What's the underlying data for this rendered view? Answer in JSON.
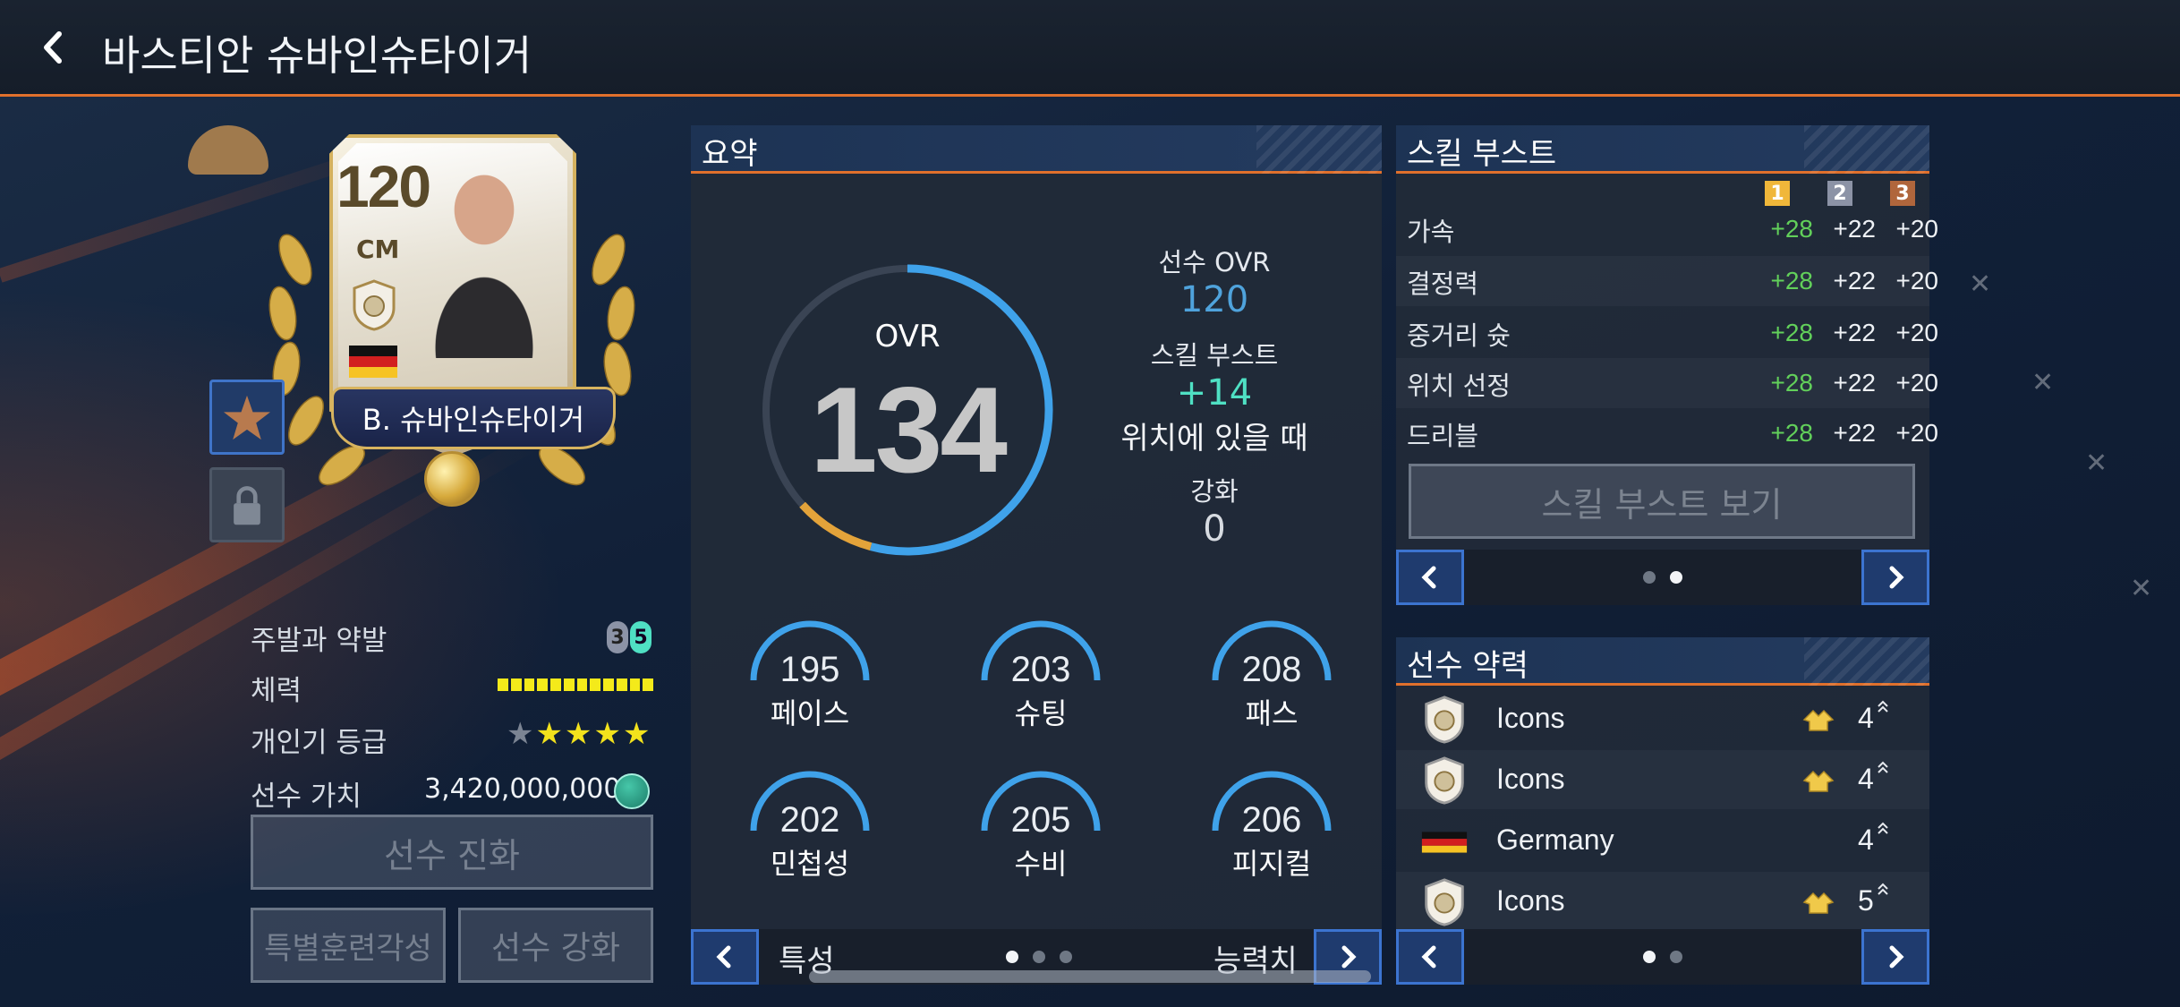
{
  "header": {
    "title": "바스티안 슈바인슈타이거"
  },
  "card": {
    "ovr": "120",
    "position": "CM",
    "name": "B. 슈바인슈타이거"
  },
  "profile": {
    "foot_label": "주발과 약발",
    "foot_left": "3",
    "foot_right": "5",
    "stamina_label": "체력",
    "popularity_label": "개인기 등급",
    "popularity_stars": 4,
    "value_label": "선수 가치",
    "value": "3,420,000,000",
    "evolve_button": "선수 진화",
    "special_training_button": "특별훈련각성",
    "enhance_button": "선수 강화"
  },
  "summary": {
    "title": "요약",
    "ovr_label": "OVR",
    "ovr_value": "134",
    "player_ovr_label": "선수 OVR",
    "player_ovr_value": "120",
    "skill_boost_label": "스킬 부스트",
    "skill_boost_value": "+14",
    "skill_boost_note": "위치에 있을 때",
    "enhance_label": "강화",
    "enhance_value": "0",
    "stats": [
      {
        "name": "페이스",
        "value": "195"
      },
      {
        "name": "슈팅",
        "value": "203"
      },
      {
        "name": "패스",
        "value": "208"
      },
      {
        "name": "민첩성",
        "value": "202"
      },
      {
        "name": "수비",
        "value": "205"
      },
      {
        "name": "피지컬",
        "value": "206"
      }
    ],
    "nav_left_label": "특성",
    "nav_right_label": "능력치"
  },
  "skill_boost": {
    "title": "스킬 부스트",
    "ranks": [
      "1",
      "2",
      "3"
    ],
    "rows": [
      {
        "name": "가속",
        "v1": "+28",
        "v2": "+22",
        "v3": "+20"
      },
      {
        "name": "결정력",
        "v1": "+28",
        "v2": "+22",
        "v3": "+20"
      },
      {
        "name": "중거리 슛",
        "v1": "+28",
        "v2": "+22",
        "v3": "+20"
      },
      {
        "name": "위치 선정",
        "v1": "+28",
        "v2": "+22",
        "v3": "+20"
      },
      {
        "name": "드리블",
        "v1": "+28",
        "v2": "+22",
        "v3": "+20"
      }
    ],
    "view_button": "스킬 부스트 보기"
  },
  "chemistry": {
    "title": "선수 약력",
    "rows": [
      {
        "name": "Icons",
        "count": "4",
        "type": "icons"
      },
      {
        "name": "Icons",
        "count": "4",
        "type": "icons"
      },
      {
        "name": "Germany",
        "count": "4",
        "type": "flag"
      },
      {
        "name": "Icons",
        "count": "5",
        "type": "icons"
      }
    ]
  },
  "colors": {
    "accent_orange": "#e0702c",
    "gauge_blue": "#3fa2ea",
    "gauge_gold": "#e3a33a",
    "boost_green": "#62d05a",
    "boost_teal": "#4fe0c3",
    "ovr_blue": "#4fa3dc",
    "rank1": "#f0b73a",
    "rank2": "#8c93a6",
    "rank3": "#b0663c"
  },
  "icons": {
    "back": "chevron-left-icon",
    "favorite": "star-icon",
    "lock": "lock-icon",
    "prev": "chevron-left-icon",
    "next": "chevron-right-icon",
    "currency": "jersey-coin-icon",
    "icons_badge": "icons-badge-icon",
    "german_flag": "german-flag-icon",
    "team_color": "gold-jersey-icon",
    "level_up": "double-chevron-up-icon"
  }
}
